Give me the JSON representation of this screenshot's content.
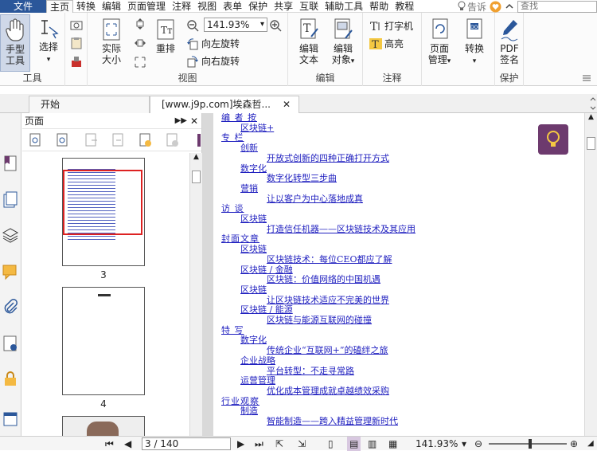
{
  "menu": {
    "file": "文件",
    "items": [
      "主页",
      "转换",
      "编辑",
      "页面管理",
      "注释",
      "视图",
      "表单",
      "保护",
      "共享",
      "互联",
      "辅助工具",
      "帮助",
      "教程"
    ],
    "tell": "告诉",
    "search_placeholder": "查找"
  },
  "ribbon": {
    "hand": "手型",
    "hand2": "工具",
    "select": "选择",
    "tools_label": "工具",
    "actual": "实际",
    "actual2": "大小",
    "reflow": "重排",
    "zoom": "141.93%",
    "rot_left": "向左旋转",
    "rot_right": "向右旋转",
    "view_label": "视图",
    "edit_text": "编辑",
    "edit_text2": "文本",
    "edit_obj": "编辑",
    "edit_obj2": "对象",
    "edit_label": "编辑",
    "typewriter": "打字机",
    "highlight": "高亮",
    "annot_label": "注释",
    "page_mgmt": "页面",
    "page_mgmt2": "管理",
    "convert": "转换",
    "pdf_sign": "PDF",
    "pdf_sign2": "签名",
    "protect_label": "保护"
  },
  "tabs": {
    "start": "开始",
    "doc": "[www.j9p.com]埃森哲..."
  },
  "panel": {
    "title": "页面",
    "pages": [
      "3",
      "4"
    ]
  },
  "toc": [
    {
      "t": "编 者 按",
      "lvl": 0
    },
    {
      "t": "区块链+",
      "lvl": 1
    },
    {
      "t": "专 栏",
      "lvl": 0
    },
    {
      "t": "创新",
      "lvl": 1
    },
    {
      "t": "开放式创新的四种正确打开方式",
      "lvl": 2
    },
    {
      "t": "数字化",
      "lvl": 1
    },
    {
      "t": "数字化转型三步曲",
      "lvl": 2
    },
    {
      "t": "营销",
      "lvl": 1
    },
    {
      "t": "让以客户为中心落地成真",
      "lvl": 2
    },
    {
      "t": "访 谈",
      "lvl": 0
    },
    {
      "t": "区块链",
      "lvl": 1
    },
    {
      "t": "打造信任机器——区块链技术及其应用",
      "lvl": 2
    },
    {
      "t": "封面文章",
      "lvl": 0
    },
    {
      "t": "区块链",
      "lvl": 1
    },
    {
      "t": "区块链技术：每位CEO都应了解",
      "lvl": 2
    },
    {
      "t": "区块链 / 金融",
      "lvl": 1
    },
    {
      "t": "区块链：价值网络的中国机遇",
      "lvl": 2
    },
    {
      "t": "区块链",
      "lvl": 1
    },
    {
      "t": "让区块链技术适应不完美的世界",
      "lvl": 2
    },
    {
      "t": "区块链 / 能源",
      "lvl": 1
    },
    {
      "t": "区块链与能源互联网的碰撞",
      "lvl": 2
    },
    {
      "t": "特 写",
      "lvl": 0
    },
    {
      "t": "数字化",
      "lvl": 1
    },
    {
      "t": "传统企业“互联网+”的磕绊之旅",
      "lvl": 2
    },
    {
      "t": "企业战略",
      "lvl": 1
    },
    {
      "t": "平台转型：不走寻常路",
      "lvl": 2
    },
    {
      "t": "运营管理",
      "lvl": 1
    },
    {
      "t": "优化成本管理成就卓越绩效采购",
      "lvl": 2
    },
    {
      "t": "行业观察",
      "lvl": 0
    },
    {
      "t": "制造",
      "lvl": 1
    },
    {
      "t": "智能制造——跨入精益管理新时代",
      "lvl": 2
    }
  ],
  "status": {
    "page": "3 / 140",
    "zoom": "141.93%"
  }
}
